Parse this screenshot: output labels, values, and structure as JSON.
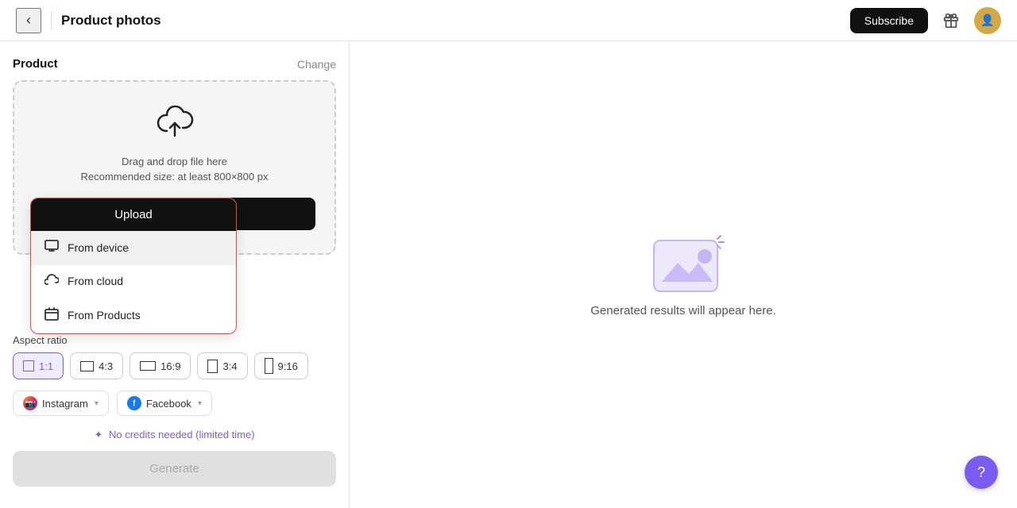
{
  "header": {
    "title": "Product photos",
    "back_label": "‹",
    "subscribe_label": "Subscribe"
  },
  "left_panel": {
    "section_title": "Product",
    "change_label": "Change",
    "upload_area": {
      "hint_line1": "Drag and drop file here",
      "hint_line2": "Recommended size: at least 800×800 px"
    },
    "upload_button_label": "Upload",
    "dropdown": {
      "upload_label": "Upload",
      "items": [
        {
          "id": "from-device",
          "label": "From device",
          "icon": "monitor"
        },
        {
          "id": "from-cloud",
          "label": "From cloud",
          "icon": "cloud"
        },
        {
          "id": "from-products",
          "label": "From Products",
          "icon": "box"
        }
      ]
    },
    "aspect_ratio": {
      "label": "Aspect ratio",
      "options": [
        {
          "id": "1:1",
          "label": "1:1",
          "active": true
        },
        {
          "id": "4:3",
          "label": "4:3",
          "active": false
        },
        {
          "id": "16:9",
          "label": "16:9",
          "active": false
        },
        {
          "id": "3:4",
          "label": "3:4",
          "active": false
        },
        {
          "id": "9:16",
          "label": "9:16",
          "active": false
        }
      ]
    },
    "social": {
      "instagram_label": "Instagram",
      "facebook_label": "Facebook"
    },
    "credits_text": "No credits needed (limited time)",
    "generate_label": "Generate"
  },
  "right_panel": {
    "empty_text": "Generated results will appear here."
  },
  "help_label": "?"
}
